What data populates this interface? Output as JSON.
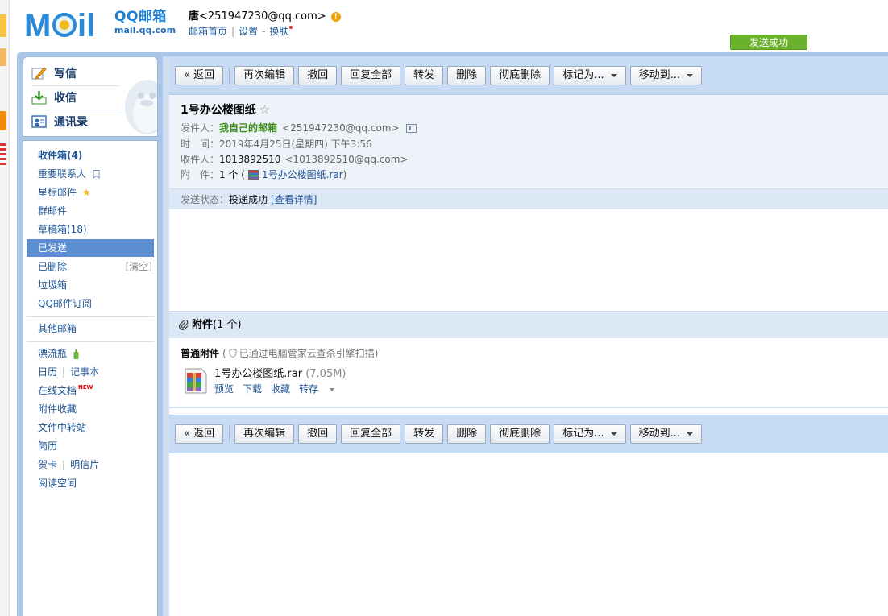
{
  "header": {
    "brand": "QQ邮箱",
    "domain": "mail.qq.com",
    "user_name": "唐",
    "user_email": "<251947230@qq.com>",
    "links": [
      "邮箱首页",
      "设置",
      "换肤"
    ],
    "send_success": "发送成功"
  },
  "compose": {
    "write": "写信",
    "inbox": "收信",
    "contacts": "通讯录"
  },
  "folders": {
    "inbox": "收件箱(4)",
    "important": "重要联系人",
    "starred": "星标邮件",
    "group": "群邮件",
    "drafts": "草稿箱(18)",
    "sent": "已发送",
    "deleted": "已删除",
    "clear": "[清空]",
    "spam": "垃圾箱",
    "subscribe": "QQ邮件订阅",
    "other": "其他邮箱",
    "bottle": "漂流瓶",
    "calendar": "日历",
    "notes": "记事本",
    "online_docs": "在线文档",
    "new_badge": "NEW",
    "attach_fav": "附件收藏",
    "file_transfer": "文件中转站",
    "resume": "简历",
    "card": "贺卡",
    "postcard": "明信片",
    "reading": "阅读空间"
  },
  "toolbar": {
    "back": "« 返回",
    "reedit": "再次编辑",
    "recall": "撤回",
    "reply_all": "回复全部",
    "forward": "转发",
    "delete": "删除",
    "delete_perm": "彻底删除",
    "mark_as": "标记为...",
    "move_to": "移动到..."
  },
  "mail": {
    "subject": "1号办公楼图纸",
    "from_label": "发件人：",
    "from_name": "我自己的邮箱",
    "from_addr": "<251947230@qq.com>",
    "time_label": "时　间：",
    "time_value": "2019年4月25日(星期四) 下午3:56",
    "to_label": "收件人：",
    "to_name": "1013892510",
    "to_addr": "<1013892510@qq.com>",
    "attach_label": "附　件：",
    "attach_count": "1 个 (",
    "attach_name": "1号办公楼图纸.rar",
    "attach_close": ")",
    "status_label": "发送状态：",
    "status_value": "投递成功",
    "status_link": "[查看详情]"
  },
  "attachment": {
    "header_title": "附件",
    "header_count": "(1 个)",
    "section_title": "普通附件",
    "scan_open": "(",
    "scan_note": "已通过电脑管家云查杀引擎扫描",
    "scan_close": ")",
    "file_name": "1号办公楼图纸.rar",
    "file_size": "(7.05M)",
    "actions": {
      "preview": "预览",
      "download": "下载",
      "favorite": "收藏",
      "save_to": "转存"
    }
  }
}
